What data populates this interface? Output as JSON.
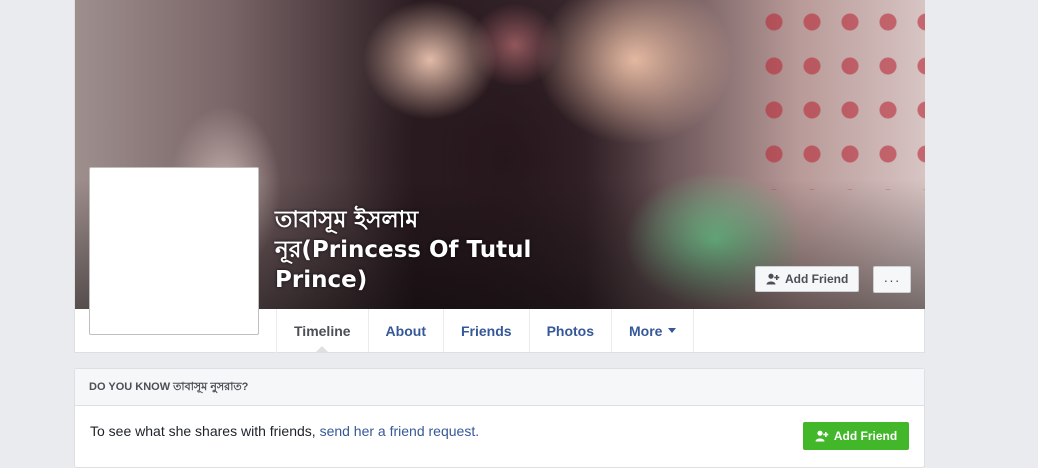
{
  "profile": {
    "name": "তাবাসূম ইসলাম নূর(Princess Of Tutul Prince)"
  },
  "cover_actions": {
    "add_friend_label": "Add Friend",
    "more_label": "···"
  },
  "nav": {
    "tabs": [
      {
        "label": "Timeline",
        "active": true
      },
      {
        "label": "About"
      },
      {
        "label": "Friends"
      },
      {
        "label": "Photos"
      },
      {
        "label": "More"
      }
    ]
  },
  "know_card": {
    "header": "DO YOU KNOW তাবাসূম নুসরাত?",
    "text_before": "To see what she shares with friends, ",
    "link": "send her a friend request.",
    "button_label": "Add Friend"
  },
  "colors": {
    "link": "#365899",
    "green_button": "#42b72a",
    "background": "#e9ebee"
  }
}
